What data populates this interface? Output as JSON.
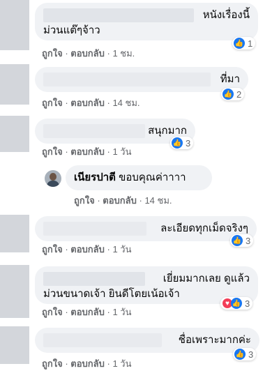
{
  "comments": [
    {
      "text_line1": "หนังเรื่องนี้",
      "text_line2": "ม่วนแต๊ๆจ้าว",
      "actions": {
        "like": "ถูกใจ",
        "reply": "ตอบกลับ",
        "time": "1 ชม."
      },
      "reactions": {
        "types": [
          "like"
        ],
        "count": "1"
      }
    },
    {
      "text_line1": "ที่มา",
      "actions": {
        "like": "ถูกใจ",
        "reply": "ตอบกลับ",
        "time": "14 ชม."
      },
      "reactions": {
        "types": [
          "like"
        ],
        "count": "2"
      }
    },
    {
      "text_line1": "สนุกมาก",
      "actions": {
        "like": "ถูกใจ",
        "reply": "ตอบกลับ",
        "time": "1 วัน"
      },
      "reactions": {
        "types": [
          "like"
        ],
        "count": "3"
      }
    },
    {
      "author": "เนียรปาตี",
      "text_line1": "ขอบคุณค่าาาา",
      "actions": {
        "like": "ถูกใจ",
        "reply": "ตอบกลับ",
        "time": "14 ชม."
      },
      "is_reply": true
    },
    {
      "text_line1": "ละเอียดทุกเม็ดจริงๆ",
      "actions": {
        "like": "ถูกใจ",
        "reply": "ตอบกลับ",
        "time": "1 วัน"
      },
      "reactions": {
        "types": [
          "like"
        ],
        "count": "3"
      }
    },
    {
      "text_line1": "เยี่ยมมากเลย ดูแล้ว",
      "text_line2": "ม่วนขนาดเจ้า ยินดีโตยเน้อเจ้า",
      "actions": {
        "like": "ถูกใจ",
        "reply": "ตอบกลับ",
        "time": "1 วัน"
      },
      "reactions": {
        "types": [
          "love",
          "like"
        ],
        "count": "3"
      }
    },
    {
      "text_line1": "ชื่อเพราะมากค่ะ",
      "actions": {
        "like": "ถูกใจ",
        "reply": "ตอบกลับ",
        "time": "1 วัน"
      },
      "reactions": {
        "types": [
          "like"
        ],
        "count": "3"
      }
    }
  ],
  "separator": " · ",
  "icons": {
    "like": "thumbs-up-icon",
    "love": "heart-icon"
  },
  "colors": {
    "like": "#1877f2",
    "love": "#f33e58",
    "bubble": "#f0f2f5",
    "meta": "#65676b"
  }
}
